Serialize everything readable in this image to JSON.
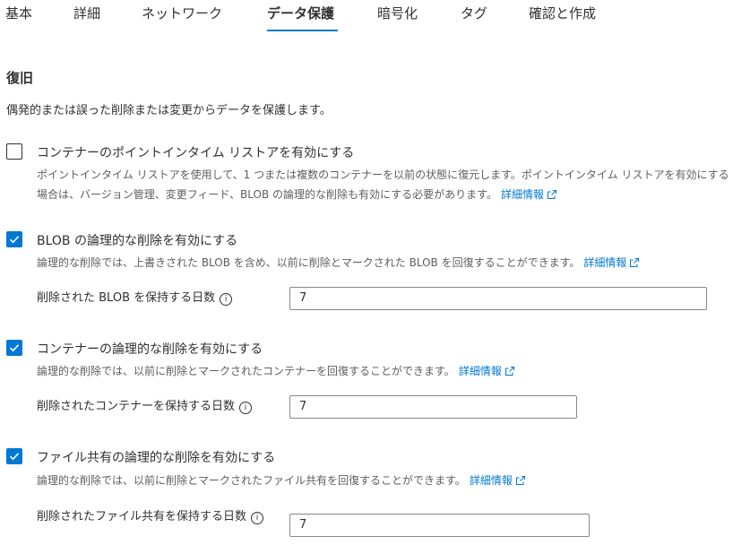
{
  "tabs": [
    {
      "label": "基本",
      "active": false
    },
    {
      "label": "詳細",
      "active": false
    },
    {
      "label": "ネットワーク",
      "active": false
    },
    {
      "label": "データ保護",
      "active": true
    },
    {
      "label": "暗号化",
      "active": false
    },
    {
      "label": "タグ",
      "active": false
    },
    {
      "label": "確認と作成",
      "active": false
    }
  ],
  "section": {
    "title": "復旧",
    "intro": "偶発的または誤った削除または変更からデータを保護します。"
  },
  "options": {
    "point_in_time": {
      "checked": false,
      "label": "コンテナーのポイントインタイム リストアを有効にする",
      "description": "ポイントインタイム リストアを使用して、1 つまたは複数のコンテナーを以前の状態に復元します。ポイントインタイム リストアを有効にする場合は、バージョン管理、変更フィード、BLOB の論理的な削除も有効にする必要があります。",
      "link": "詳細情報"
    },
    "blob_soft_delete": {
      "checked": true,
      "label": "BLOB の論理的な削除を有効にする",
      "description": "論理的な削除では、上書きされた BLOB を含め、以前に削除とマークされた BLOB を回復することができます。",
      "link": "詳細情報",
      "field_label": "削除された BLOB を保持する日数",
      "field_value": "7"
    },
    "container_soft_delete": {
      "checked": true,
      "label": "コンテナーの論理的な削除を有効にする",
      "description": "論理的な削除では、以前に削除とマークされたコンテナーを回復することができます。",
      "link": "詳細情報",
      "field_label": "削除されたコンテナーを保持する日数",
      "field_value": "7"
    },
    "file_share_soft_delete": {
      "checked": true,
      "label": "ファイル共有の論理的な削除を有効にする",
      "description": "論理的な削除では、以前に削除とマークされたファイル共有を回復することができます。",
      "link": "詳細情報",
      "field_label": "削除されたファイル共有を保持する日数",
      "field_value": "7"
    }
  },
  "icons": {
    "info": "i"
  },
  "colors": {
    "accent": "#0078d4",
    "text": "#323130",
    "secondary_text": "#605e5c"
  }
}
